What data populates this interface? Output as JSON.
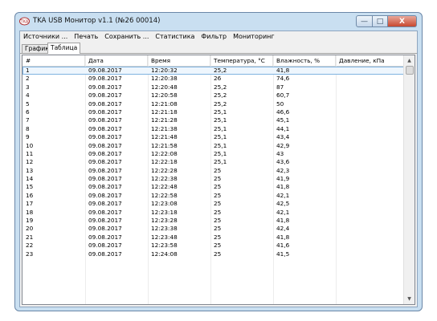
{
  "window": {
    "title": "TKA USB Монитор v1.1 (№26 00014)",
    "controls": {
      "minimize": "—",
      "maximize": "□",
      "close": "X"
    }
  },
  "menu": [
    "Источники ...",
    "Печать",
    "Сохранить ...",
    "Статистика",
    "Фильтр",
    "Мониторинг"
  ],
  "tabs": [
    {
      "label": "Графики",
      "active": false
    },
    {
      "label": "Таблица",
      "active": true
    }
  ],
  "table": {
    "columns": [
      "#",
      "Дата",
      "Время",
      "Температура, °С",
      "Влажность, %",
      "Давление, кПа"
    ],
    "rows": [
      [
        "1",
        "09.08.2017",
        "12:20:32",
        "25,2",
        "41,8",
        ""
      ],
      [
        "2",
        "09.08.2017",
        "12:20:38",
        "26",
        "74,6",
        ""
      ],
      [
        "3",
        "09.08.2017",
        "12:20:48",
        "25,2",
        "87",
        ""
      ],
      [
        "4",
        "09.08.2017",
        "12:20:58",
        "25,2",
        "60,7",
        ""
      ],
      [
        "5",
        "09.08.2017",
        "12:21:08",
        "25,2",
        "50",
        ""
      ],
      [
        "6",
        "09.08.2017",
        "12:21:18",
        "25,1",
        "46,6",
        ""
      ],
      [
        "7",
        "09.08.2017",
        "12:21:28",
        "25,1",
        "45,1",
        ""
      ],
      [
        "8",
        "09.08.2017",
        "12:21:38",
        "25,1",
        "44,1",
        ""
      ],
      [
        "9",
        "09.08.2017",
        "12:21:48",
        "25,1",
        "43,4",
        ""
      ],
      [
        "10",
        "09.08.2017",
        "12:21:58",
        "25,1",
        "42,9",
        ""
      ],
      [
        "11",
        "09.08.2017",
        "12:22:08",
        "25,1",
        "43",
        ""
      ],
      [
        "12",
        "09.08.2017",
        "12:22:18",
        "25,1",
        "43,6",
        ""
      ],
      [
        "13",
        "09.08.2017",
        "12:22:28",
        "25",
        "42,3",
        ""
      ],
      [
        "14",
        "09.08.2017",
        "12:22:38",
        "25",
        "41,9",
        ""
      ],
      [
        "15",
        "09.08.2017",
        "12:22:48",
        "25",
        "41,8",
        ""
      ],
      [
        "16",
        "09.08.2017",
        "12:22:58",
        "25",
        "42,1",
        ""
      ],
      [
        "17",
        "09.08.2017",
        "12:23:08",
        "25",
        "42,5",
        ""
      ],
      [
        "18",
        "09.08.2017",
        "12:23:18",
        "25",
        "42,1",
        ""
      ],
      [
        "19",
        "09.08.2017",
        "12:23:28",
        "25",
        "41,8",
        ""
      ],
      [
        "20",
        "09.08.2017",
        "12:23:38",
        "25",
        "42,4",
        ""
      ],
      [
        "21",
        "09.08.2017",
        "12:23:48",
        "25",
        "41,8",
        ""
      ],
      [
        "22",
        "09.08.2017",
        "12:23:58",
        "25",
        "41,6",
        ""
      ],
      [
        "23",
        "09.08.2017",
        "12:24:08",
        "25",
        "41,5",
        ""
      ]
    ],
    "selected_row": 0
  },
  "scrollbar": {
    "up": "▲",
    "down": "▼"
  },
  "colors": {
    "frame": "#c9dff1",
    "selection": "#7fb3e0",
    "close_button": "#c7482f"
  }
}
